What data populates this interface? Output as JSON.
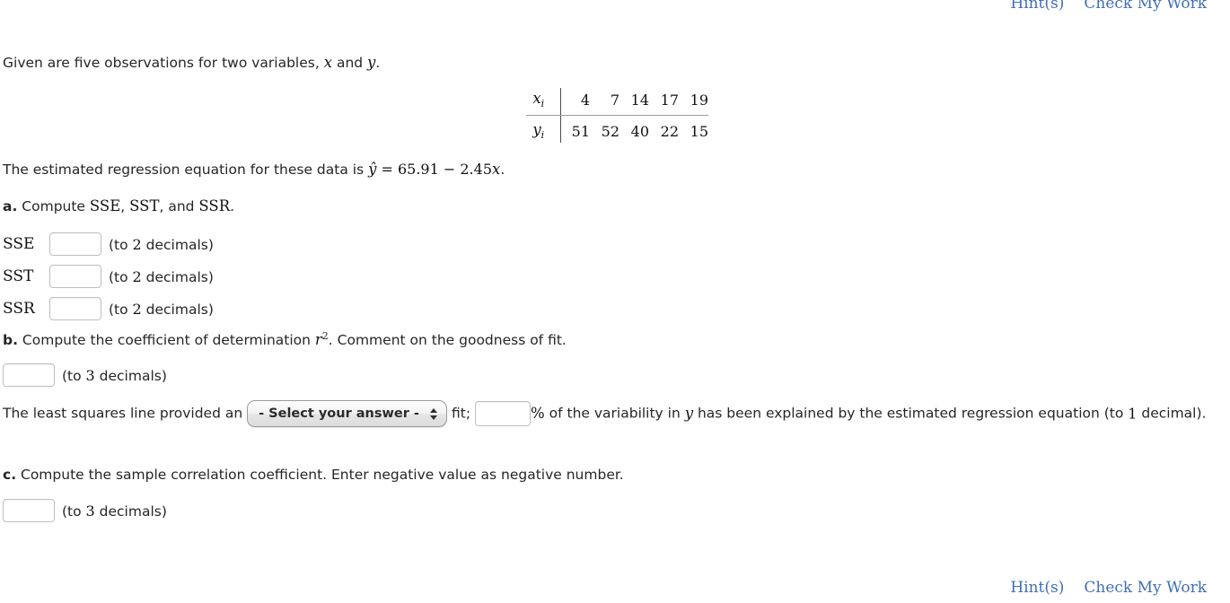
{
  "top_links": [
    {
      "label": "Hint(s)"
    },
    {
      "label": "Check My Work"
    }
  ],
  "bottom_links": [
    {
      "label": "Hint(s)"
    },
    {
      "label": "Check My Work"
    }
  ],
  "intro": {
    "text_before": "Given are five observations for two variables, ",
    "var_x": "x",
    "text_and": " and ",
    "var_y": "y",
    "text_end": "."
  },
  "table": {
    "x_label": "x",
    "x_sub": "i",
    "y_label": "y",
    "y_sub": "i",
    "x_values": [
      "4",
      "7",
      "14",
      "17",
      "19"
    ],
    "y_values": [
      "51",
      "52",
      "40",
      "22",
      "15"
    ]
  },
  "equation": {
    "text_before": "The estimated regression equation for these data is ",
    "yhat": "ŷ",
    "equals": " = ",
    "intercept": "65.91",
    "minus": " − ",
    "slope": "2.45",
    "var_x": "x",
    "period": "."
  },
  "part_a": {
    "letter": "a.",
    "text_compute": " Compute ",
    "sse": "SSE",
    "comma1": ", ",
    "sst": "SST",
    "comma2": ", and ",
    "ssr": "SSR",
    "period": ".",
    "rows": [
      {
        "label": "SSE",
        "value": "",
        "note_before": "(to ",
        "decimals": "2",
        "note_after": " decimals)"
      },
      {
        "label": "SST",
        "value": "",
        "note_before": "(to ",
        "decimals": "2",
        "note_after": " decimals)"
      },
      {
        "label": "SSR",
        "value": "",
        "note_before": "(to ",
        "decimals": "2",
        "note_after": " decimals)"
      }
    ]
  },
  "part_b": {
    "letter": "b.",
    "text1": " Compute the coefficient of determination ",
    "r_var": "r",
    "r_exp": "2",
    "text2": ". Comment on the goodness of fit.",
    "r2_input": {
      "value": "",
      "note_before": "(to ",
      "decimals": "3",
      "note_after": " decimals)"
    },
    "sentence": {
      "lead": "The least squares line provided an ",
      "select_value": "- Select your answer -",
      "select_options": [
        "- Select your answer -"
      ],
      "after_select": " fit; ",
      "pct_value": "",
      "percent_symbol": "%",
      "tail": " of the variability in ",
      "var_y": "y",
      "tail2": " has been explained by the estimated regression equation (to ",
      "decimals": "1",
      "tail3": " decimal)."
    }
  },
  "part_c": {
    "letter": "c.",
    "text": " Compute the sample correlation coefficient. Enter negative value as negative number.",
    "input": {
      "value": "",
      "note_before": "(to ",
      "decimals": "3",
      "note_after": " decimals)"
    }
  },
  "colors": {
    "link_blue": "#3f6eb5",
    "text": "#262626",
    "input_border": "#bfbfbf"
  }
}
